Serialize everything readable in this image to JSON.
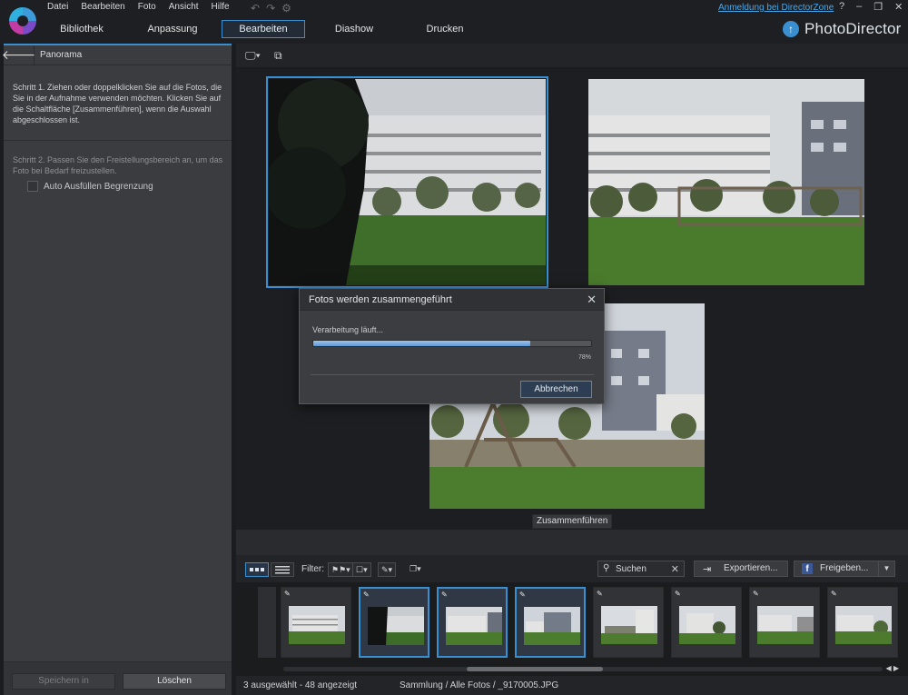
{
  "app": {
    "menu": [
      "Datei",
      "Bearbeiten",
      "Foto",
      "Ansicht",
      "Hilfe"
    ],
    "login_link": "Anmeldung bei DirectorZone",
    "help": "?",
    "brand": "PhotoDirector",
    "tabs": [
      "Bibliothek",
      "Anpassung",
      "Bearbeiten",
      "Diashow",
      "Drucken"
    ],
    "active_tab": "Bearbeiten",
    "accent": "#3a8fd1"
  },
  "left_panel": {
    "title": "Panorama",
    "step1": "Schritt 1. Ziehen oder doppelklicken Sie auf die Fotos, die Sie in der Aufnahme verwenden möchten. Klicken Sie auf die Schaltfläche [Zusammenführen], wenn die Auswahl abgeschlossen ist.",
    "step2": "Schritt 2. Passen Sie den Freistellungsbereich an, um das Foto bei Bedarf freizustellen.",
    "checkbox_label": "Auto Ausfüllen Begrenzung",
    "checkbox_checked": false,
    "save_label": "Speichern in",
    "delete_label": "Löschen"
  },
  "stage": {
    "combine_label": "Zusammenführen"
  },
  "dialog": {
    "title": "Fotos werden zusammengeführt",
    "status": "Verarbeitung läuft...",
    "progress": 0.78,
    "progress_label": "78%",
    "cancel_label": "Abbrechen"
  },
  "filmstrip": {
    "filter_label": "Filter:",
    "search_placeholder": "Suchen",
    "export_label": "Exportieren...",
    "share_label": "Freigeben...",
    "thumbnails": [
      {
        "selected": false,
        "scene": "building-left"
      },
      {
        "selected": true,
        "scene": "tree-dark"
      },
      {
        "selected": true,
        "scene": "building-wide"
      },
      {
        "selected": true,
        "scene": "grey-building"
      },
      {
        "selected": false,
        "scene": "tower"
      },
      {
        "selected": false,
        "scene": "building-trees"
      },
      {
        "selected": false,
        "scene": "building-right"
      },
      {
        "selected": false,
        "scene": "building-partial"
      }
    ]
  },
  "status": {
    "selection": "3 ausgewählt - 48 angezeigt",
    "path": "Sammlung / Alle Fotos / _9170005.JPG"
  }
}
